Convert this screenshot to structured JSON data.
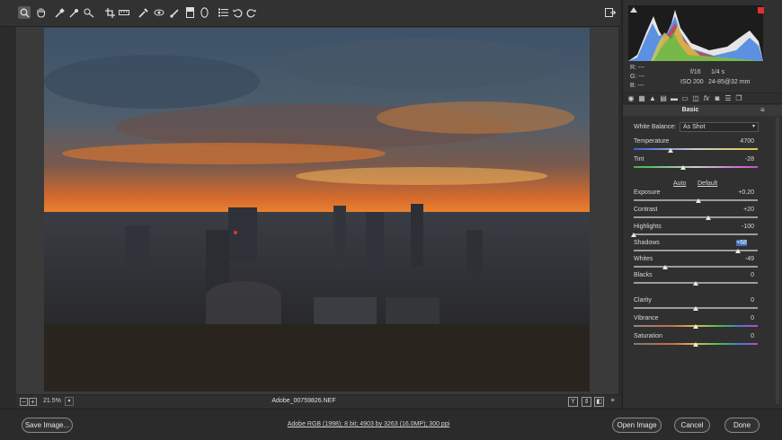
{
  "toolbar": {
    "tools": [
      "zoom-tool-icon",
      "hand-tool-icon",
      "white-balance-tool-icon",
      "color-sampler-tool-icon",
      "targeted-adjustment-tool-icon",
      "crop-tool-icon",
      "straighten-tool-icon",
      "spot-removal-tool-icon",
      "red-eye-removal-tool-icon",
      "adjustment-brush-icon",
      "graduated-filter-icon",
      "radial-filter-icon",
      "preferences-icon",
      "rotate-left-icon",
      "rotate-right-icon"
    ],
    "fullscreen_icon": "fullscreen-icon"
  },
  "histogram": {
    "rgb": {
      "r": "R:  ---",
      "g": "G:  ---",
      "b": "B:  ---"
    },
    "aperture": "f/16",
    "shutter": "1/4 s",
    "iso": "ISO 200",
    "lens": "24-85@32 mm"
  },
  "panel": {
    "section_title": "Basic",
    "white_balance": {
      "label": "White Balance:",
      "value": "As Shot"
    },
    "auto_label": "Auto",
    "default_label": "Default",
    "adjustments": {
      "temperature": {
        "label": "Temperature",
        "value": "4700",
        "position": 0.3
      },
      "tint": {
        "label": "Tint",
        "value": "-28",
        "position": 0.4
      },
      "exposure": {
        "label": "Exposure",
        "value": "+0.20",
        "position": 0.52
      },
      "contrast": {
        "label": "Contrast",
        "value": "+20",
        "position": 0.6
      },
      "highlights": {
        "label": "Highlights",
        "value": "-100",
        "position": 0.0
      },
      "shadows": {
        "label": "Shadows",
        "value": "+68",
        "position": 0.84
      },
      "whites": {
        "label": "Whites",
        "value": "-49",
        "position": 0.25
      },
      "blacks": {
        "label": "Blacks",
        "value": "0",
        "position": 0.5
      },
      "clarity": {
        "label": "Clarity",
        "value": "0",
        "position": 0.5
      },
      "vibrance": {
        "label": "Vibrance",
        "value": "0",
        "position": 0.5
      },
      "saturation": {
        "label": "Saturation",
        "value": "0",
        "position": 0.5
      }
    }
  },
  "status": {
    "zoom": "21.5%",
    "filename": "Adobe_00759826.NEF",
    "zoom_out": "−",
    "zoom_in": "+"
  },
  "footer": {
    "save_label": "Save Image...",
    "workflow_options": "Adobe RGB (1998); 8 bit; 4903 by 3263 (16.0MP); 300 ppi",
    "open_label": "Open Image",
    "cancel_label": "Cancel",
    "done_label": "Done"
  },
  "colors": {
    "accent": "#3e6fb8",
    "clip_warning": "#e13030"
  }
}
